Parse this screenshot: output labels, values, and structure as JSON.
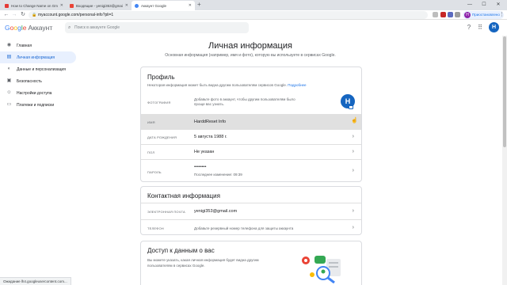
{
  "browser": {
    "tabs": [
      {
        "title": "How to Change Name on Gmai...",
        "fav_color": "#e53935",
        "active": false
      },
      {
        "title": "Входящие - yenigi353@gmail.c...",
        "fav_color": "#ea4335",
        "active": false
      },
      {
        "title": "Аккаунт Google",
        "fav_color": "#4285f4",
        "active": true
      }
    ],
    "new_tab": "+",
    "window_controls": {
      "minimize": "—",
      "maximize": "☐",
      "close": "✕"
    },
    "url": "myaccount.google.com/personal-info?pli=1",
    "paused_label": "Приостановлено",
    "paused_avatar": "Н"
  },
  "account_header": {
    "logo_letters": [
      {
        "ch": "G",
        "color": "#4285f4"
      },
      {
        "ch": "o",
        "color": "#ea4335"
      },
      {
        "ch": "o",
        "color": "#fbbc05"
      },
      {
        "ch": "g",
        "color": "#4285f4"
      },
      {
        "ch": "l",
        "color": "#34a853"
      },
      {
        "ch": "e",
        "color": "#ea4335"
      }
    ],
    "product": "Аккаунт",
    "search_placeholder": "Поиск в аккаунте Google",
    "avatar_letter": "Н"
  },
  "sidebar": {
    "items": [
      {
        "label": "Главная",
        "icon": "person-circle-icon",
        "glyph": "◉",
        "active": false
      },
      {
        "label": "Личная информация",
        "icon": "id-card-icon",
        "glyph": "▤",
        "active": true
      },
      {
        "label": "Данные и персонализация",
        "icon": "toggle-icon",
        "glyph": "◐",
        "active": false
      },
      {
        "label": "Безопасность",
        "icon": "lock-icon",
        "glyph": "▣",
        "active": false
      },
      {
        "label": "Настройки доступа",
        "icon": "people-icon",
        "glyph": "☺",
        "active": false
      },
      {
        "label": "Платежи и подписки",
        "icon": "card-icon",
        "glyph": "▭",
        "active": false
      }
    ]
  },
  "main": {
    "title": "Личная информация",
    "subtitle": "Основная информация (например, имя и фото), которую вы используете в сервисах Google.",
    "profile": {
      "title": "Профиль",
      "desc": "Некоторая информация может быть видна другим пользователям сервисов Google.",
      "more_link": "Подробнее",
      "photo": {
        "label": "ФОТОГРАФИЯ",
        "value": "Добавьте фото в аккаунт, чтобы другим пользователям было проще вас узнать.",
        "avatar_letter": "H"
      },
      "name": {
        "label": "ИМЯ",
        "value": "HarddReset Info"
      },
      "birthday": {
        "label": "ДАТА РОЖДЕНИЯ",
        "value": "5 августа 1988 г."
      },
      "gender": {
        "label": "ПОЛ",
        "value": "Не указан"
      },
      "password": {
        "label": "ПАРОЛЬ",
        "value": "••••••••",
        "changed": "Последнее изменение: 09:39"
      }
    },
    "contact": {
      "title": "Контактная информация",
      "email": {
        "label": "ЭЛЕКТРОННАЯ ПОЧТА",
        "value": "yenigi353@gmail.com"
      },
      "phone": {
        "label": "ТЕЛЕФОН",
        "value": "Добавьте резервный номер телефона для защиты аккаунта"
      }
    },
    "access": {
      "title": "Доступ к данным о вас",
      "desc": "Вы можете указать, какая личная информация будет видна другим пользователям в сервисах Google."
    }
  },
  "statusbar": {
    "text": "Ожидание lh4.googleusercontent.com..."
  },
  "colors": {
    "accent": "#1a73e8",
    "active_bg": "#e8f0fe",
    "avatar": "#1565c0"
  }
}
